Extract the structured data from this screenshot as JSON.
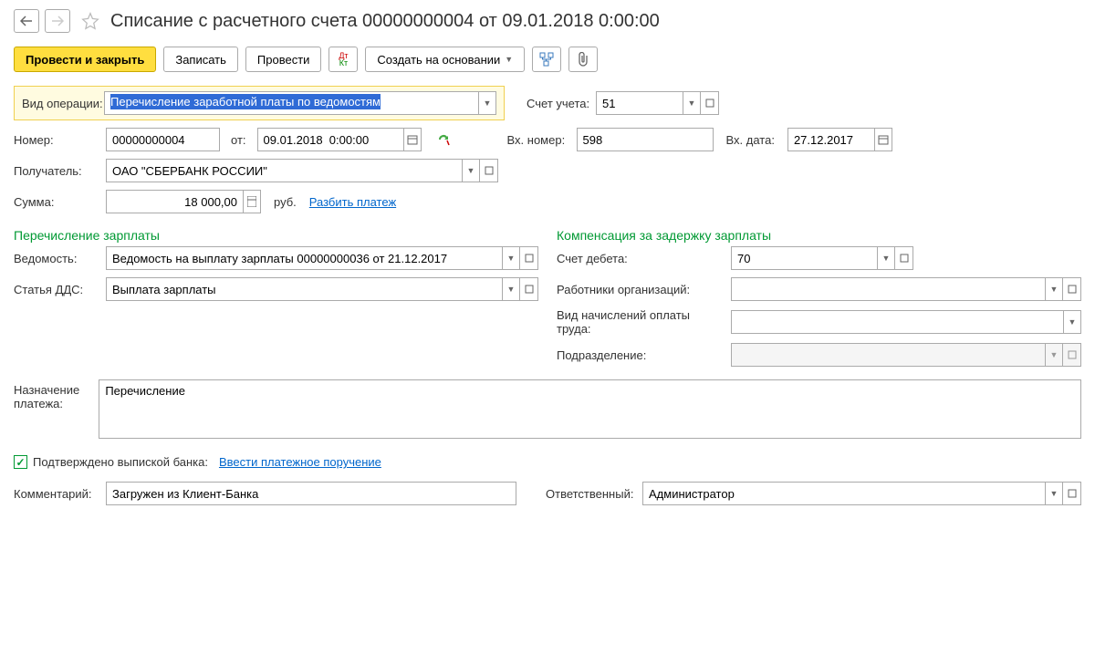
{
  "header": {
    "title": "Списание с расчетного счета 00000000004 от 09.01.2018 0:00:00"
  },
  "toolbar": {
    "post_and_close": "Провести и закрыть",
    "save": "Записать",
    "post": "Провести",
    "create_based": "Создать на основании"
  },
  "fields": {
    "operation_type_label": "Вид операции:",
    "operation_type_value": "Перечисление заработной платы по ведомостям",
    "account_label": "Счет учета:",
    "account_value": "51",
    "number_label": "Номер:",
    "number_value": "00000000004",
    "from_label": "от:",
    "date_value": "09.01.2018  0:00:00",
    "in_number_label": "Вх. номер:",
    "in_number_value": "598",
    "in_date_label": "Вх. дата:",
    "in_date_value": "27.12.2017",
    "recipient_label": "Получатель:",
    "recipient_value": "ОАО \"СБЕРБАНК РОССИИ\"",
    "sum_label": "Сумма:",
    "sum_value": "18 000,00",
    "currency": "руб.",
    "split_payment": "Разбить платеж",
    "section_salary": "Перечисление зарплаты",
    "statement_label": "Ведомость:",
    "statement_value": "Ведомость на выплату зарплаты 00000000036 от 21.12.2017",
    "dds_label": "Статья ДДС:",
    "dds_value": "Выплата зарплаты",
    "section_compensation": "Компенсация за задержку зарплаты",
    "debit_account_label": "Счет дебета:",
    "debit_account_value": "70",
    "employees_label": "Работники организаций:",
    "employees_value": "",
    "accrual_type_label": "Вид начислений оплаты труда:",
    "accrual_type_value": "",
    "subdivision_label": "Подразделение:",
    "subdivision_value": "",
    "purpose_label": "Назначение платежа:",
    "purpose_value": "Перечисление",
    "confirmed_label": "Подтверждено выпиской банка:",
    "enter_payment_order": "Ввести платежное поручение",
    "comment_label": "Комментарий:",
    "comment_value": "Загружен из Клиент-Банка",
    "responsible_label": "Ответственный:",
    "responsible_value": "Администратор"
  }
}
